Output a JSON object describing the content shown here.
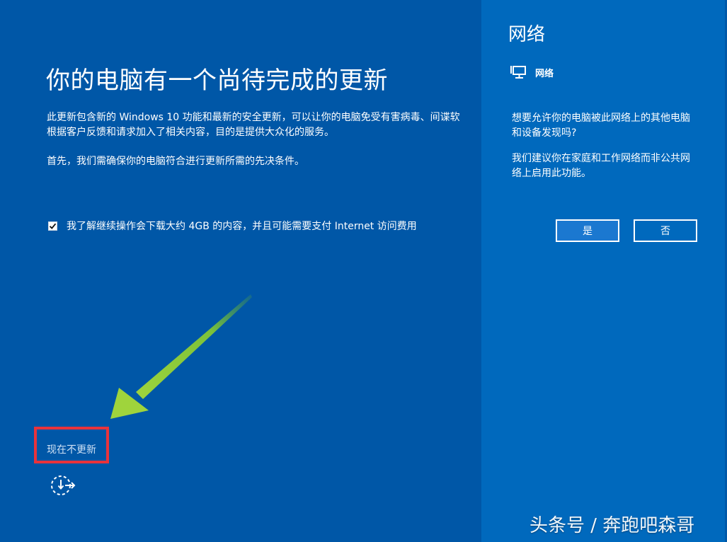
{
  "colors": {
    "main_bg": "#0057a7",
    "side_bg": "#0069bd",
    "arrow": "#8cc83c",
    "highlight": "#e8333c"
  },
  "main": {
    "title": "你的电脑有一个尚待完成的更新",
    "desc_line1": "此更新包含新的 Windows 10 功能和最新的安全更新，可以让你的电脑免受有害病毒、间谍软",
    "desc_line2": "根据客户反馈和请求加入了相关内容，目的是提供大众化的服务。",
    "prereq": "首先，我们需确保你的电脑符合进行更新所需的先决条件。",
    "checkbox_label": "我了解继续操作会下载大约 4GB 的内容，并且可能需要支付 Internet 访问费用",
    "checkbox_checked": true,
    "skip_link": "现在不更新",
    "skip_icon": "loading-spinner-icon",
    "arrow_icon": "green-arrow-icon"
  },
  "side": {
    "title": "网络",
    "network_name": "网络",
    "network_icon": "monitor-network-icon",
    "question": "想要允许你的电脑被此网络上的其他电脑和设备发现吗?",
    "recommendation": "我们建议你在家庭和工作网络而非公共网络上启用此功能。",
    "yes_label": "是",
    "no_label": "否"
  },
  "watermark": "头条号 / 奔跑吧森哥"
}
